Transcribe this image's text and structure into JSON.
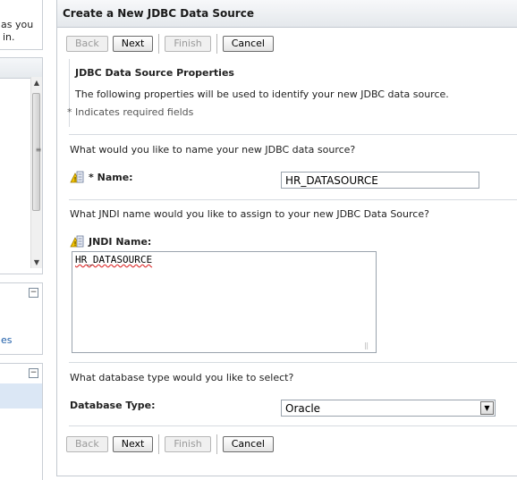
{
  "left_panels": {
    "panel1_frag1": "as you",
    "panel1_frag2": "in.",
    "panel3_link": "es"
  },
  "dialog": {
    "title": "Create a New JDBC Data Source",
    "buttons": {
      "back": "Back",
      "next": "Next",
      "finish": "Finish",
      "cancel": "Cancel"
    },
    "section_title": "JDBC Data Source Properties",
    "description": "The following properties will be used to identify your new JDBC data source.",
    "required_note": "* Indicates required fields",
    "name_question": "What would you like to name your new JDBC data source?",
    "name_required_mark": "*",
    "name_label": "Name:",
    "name_value": "HR_DATASOURCE",
    "jndi_question": "What JNDI name would you like to assign to your new JDBC Data Source?",
    "jndi_label": "JNDI Name:",
    "jndi_value": "HR_DATASOURCE",
    "dbtype_question": "What database type would you like to select?",
    "dbtype_label": "Database Type:",
    "dbtype_value": "Oracle"
  }
}
